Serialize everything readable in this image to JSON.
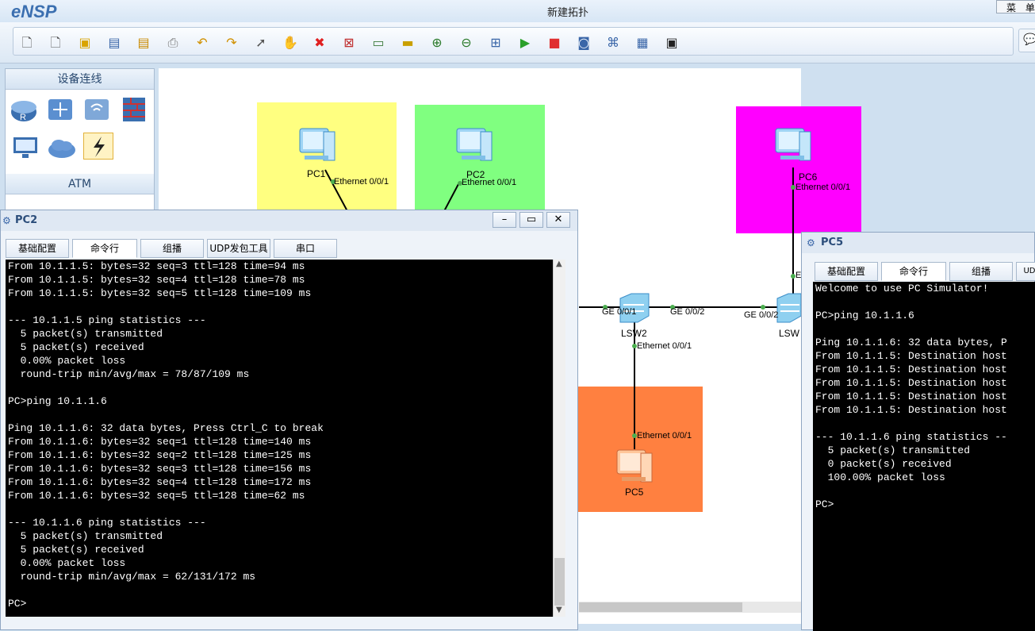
{
  "app": {
    "logo": "eNSP",
    "title": "新建拓扑",
    "menu": "菜 单"
  },
  "toolbar": {
    "icons": [
      "new-topology-icon",
      "new-test-icon",
      "open-icon",
      "save-icon",
      "save-as-icon",
      "print-icon",
      "undo-icon",
      "redo-icon",
      "select-icon",
      "pan-icon",
      "delete-icon",
      "delete-links-icon",
      "text-icon",
      "rectangle-icon",
      "zoom-in-icon",
      "zoom-out-icon",
      "fit-icon",
      "start-icon",
      "stop-icon",
      "capture-icon",
      "topology-icon",
      "grid-icon",
      "console-icon"
    ]
  },
  "left_panel": {
    "header1": "设备连线",
    "header2": "ATM",
    "devices": [
      "router-icon",
      "switch-icon",
      "wireless-icon",
      "firewall-icon",
      "pc-icon",
      "cloud-icon",
      "link-icon"
    ]
  },
  "topology": {
    "areas": [
      {
        "name": "area-yellow",
        "color": "#ffff80"
      },
      {
        "name": "area-green",
        "color": "#80ff80"
      },
      {
        "name": "area-magenta",
        "color": "#ff00ff"
      },
      {
        "name": "area-orange",
        "color": "#ff8040"
      }
    ],
    "devices": [
      "PC1",
      "PC2",
      "PC6",
      "LSW2",
      "LSW",
      "PC5"
    ],
    "ports": {
      "pc1_e": "Ethernet 0/0/1",
      "pc2_e": "Ethernet 0/0/1",
      "pc6_e": "Ethernet 0/0/1",
      "lsw2_g1": "GE 0/0/1",
      "lsw2_g2": "GE 0/0/2",
      "lsw_g2": "GE 0/0/2",
      "lsw2_e": "Ethernet 0/0/1",
      "pc5_e": "Ethernet 0/0/1",
      "lsw_e": "E"
    }
  },
  "pc2_window": {
    "title": "PC2",
    "tabs": [
      "基础配置",
      "命令行",
      "组播",
      "UDP发包工具",
      "串口"
    ],
    "active_tab": "命令行",
    "lines": [
      "From 10.1.1.5: bytes=32 seq=3 ttl=128 time=94 ms",
      "From 10.1.1.5: bytes=32 seq=4 ttl=128 time=78 ms",
      "From 10.1.1.5: bytes=32 seq=5 ttl=128 time=109 ms",
      "",
      "--- 10.1.1.5 ping statistics ---",
      "  5 packet(s) transmitted",
      "  5 packet(s) received",
      "  0.00% packet loss",
      "  round-trip min/avg/max = 78/87/109 ms",
      "",
      "PC>ping 10.1.1.6",
      "",
      "Ping 10.1.1.6: 32 data bytes, Press Ctrl_C to break",
      "From 10.1.1.6: bytes=32 seq=1 ttl=128 time=140 ms",
      "From 10.1.1.6: bytes=32 seq=2 ttl=128 time=125 ms",
      "From 10.1.1.6: bytes=32 seq=3 ttl=128 time=156 ms",
      "From 10.1.1.6: bytes=32 seq=4 ttl=128 time=172 ms",
      "From 10.1.1.6: bytes=32 seq=5 ttl=128 time=62 ms",
      "",
      "--- 10.1.1.6 ping statistics ---",
      "  5 packet(s) transmitted",
      "  5 packet(s) received",
      "  0.00% packet loss",
      "  round-trip min/avg/max = 62/131/172 ms",
      "",
      "PC>"
    ]
  },
  "pc5_window": {
    "title": "PC5",
    "tabs": [
      "基础配置",
      "命令行",
      "组播",
      "UDP"
    ],
    "active_tab": "命令行",
    "lines": [
      "Welcome to use PC Simulator!",
      "",
      "PC>ping 10.1.1.6",
      "",
      "Ping 10.1.1.6: 32 data bytes, P",
      "From 10.1.1.5: Destination host",
      "From 10.1.1.5: Destination host",
      "From 10.1.1.5: Destination host",
      "From 10.1.1.5: Destination host",
      "From 10.1.1.5: Destination host",
      "",
      "--- 10.1.1.6 ping statistics --",
      "  5 packet(s) transmitted",
      "  0 packet(s) received",
      "  100.00% packet loss",
      "",
      "PC>"
    ]
  }
}
